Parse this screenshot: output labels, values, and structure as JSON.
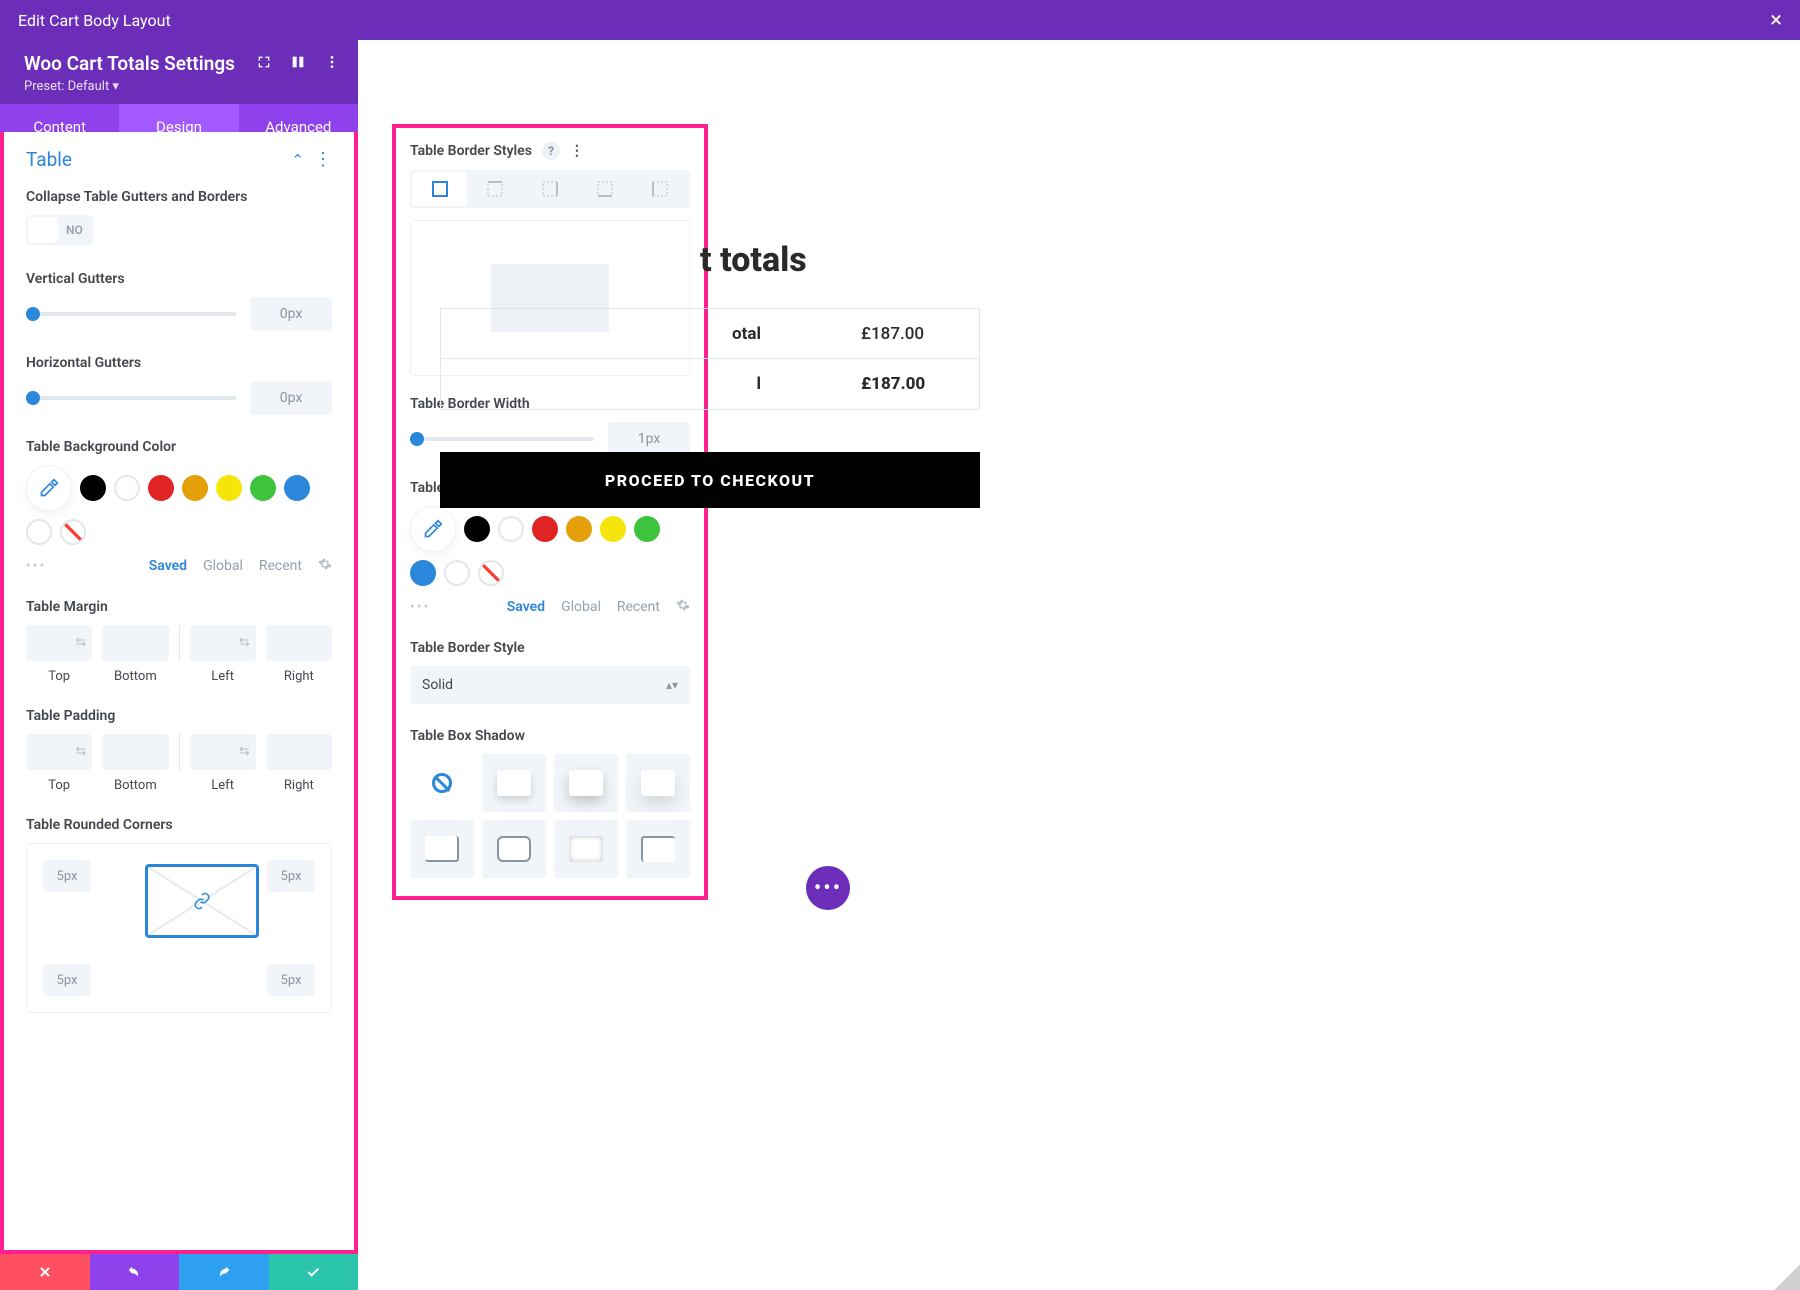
{
  "topbar": {
    "title": "Edit Cart Body Layout"
  },
  "settings": {
    "title": "Woo Cart Totals Settings",
    "preset": "Preset: Default ▾"
  },
  "tabs": {
    "content": "Content",
    "design": "Design",
    "advanced": "Advanced"
  },
  "section": {
    "title": "Table"
  },
  "collapse": {
    "label": "Collapse Table Gutters and Borders",
    "value": "NO"
  },
  "vGutters": {
    "label": "Vertical Gutters",
    "value": "0px"
  },
  "hGutters": {
    "label": "Horizontal Gutters",
    "value": "0px"
  },
  "bgColor": {
    "label": "Table Background Color"
  },
  "colors": [
    "#000000",
    "#ffffff",
    "#e02424",
    "#e3a008",
    "#f5e50b",
    "#3ec33e",
    "#2b87da",
    "#ffffff"
  ],
  "colorTabs": {
    "a": "Saved",
    "b": "Global",
    "c": "Recent"
  },
  "margin": {
    "label": "Table Margin"
  },
  "padding": {
    "label": "Table Padding"
  },
  "sides": {
    "top": "Top",
    "bottom": "Bottom",
    "left": "Left",
    "right": "Right"
  },
  "corners": {
    "label": "Table Rounded Corners",
    "v": "5px"
  },
  "p2": {
    "head": "Table Border Styles",
    "width": {
      "label": "Table Border Width",
      "value": "1px"
    },
    "color": {
      "label": "Table Border Color"
    },
    "style": {
      "label": "Table Border Style",
      "value": "Solid"
    },
    "shadow": {
      "label": "Table Box Shadow"
    }
  },
  "cart": {
    "title": "t totals",
    "subtotal_k": "otal",
    "subtotal_v": "£187.00",
    "total_k": "l",
    "total_v": "£187.00",
    "checkout": "PROCEED TO CHECKOUT"
  }
}
